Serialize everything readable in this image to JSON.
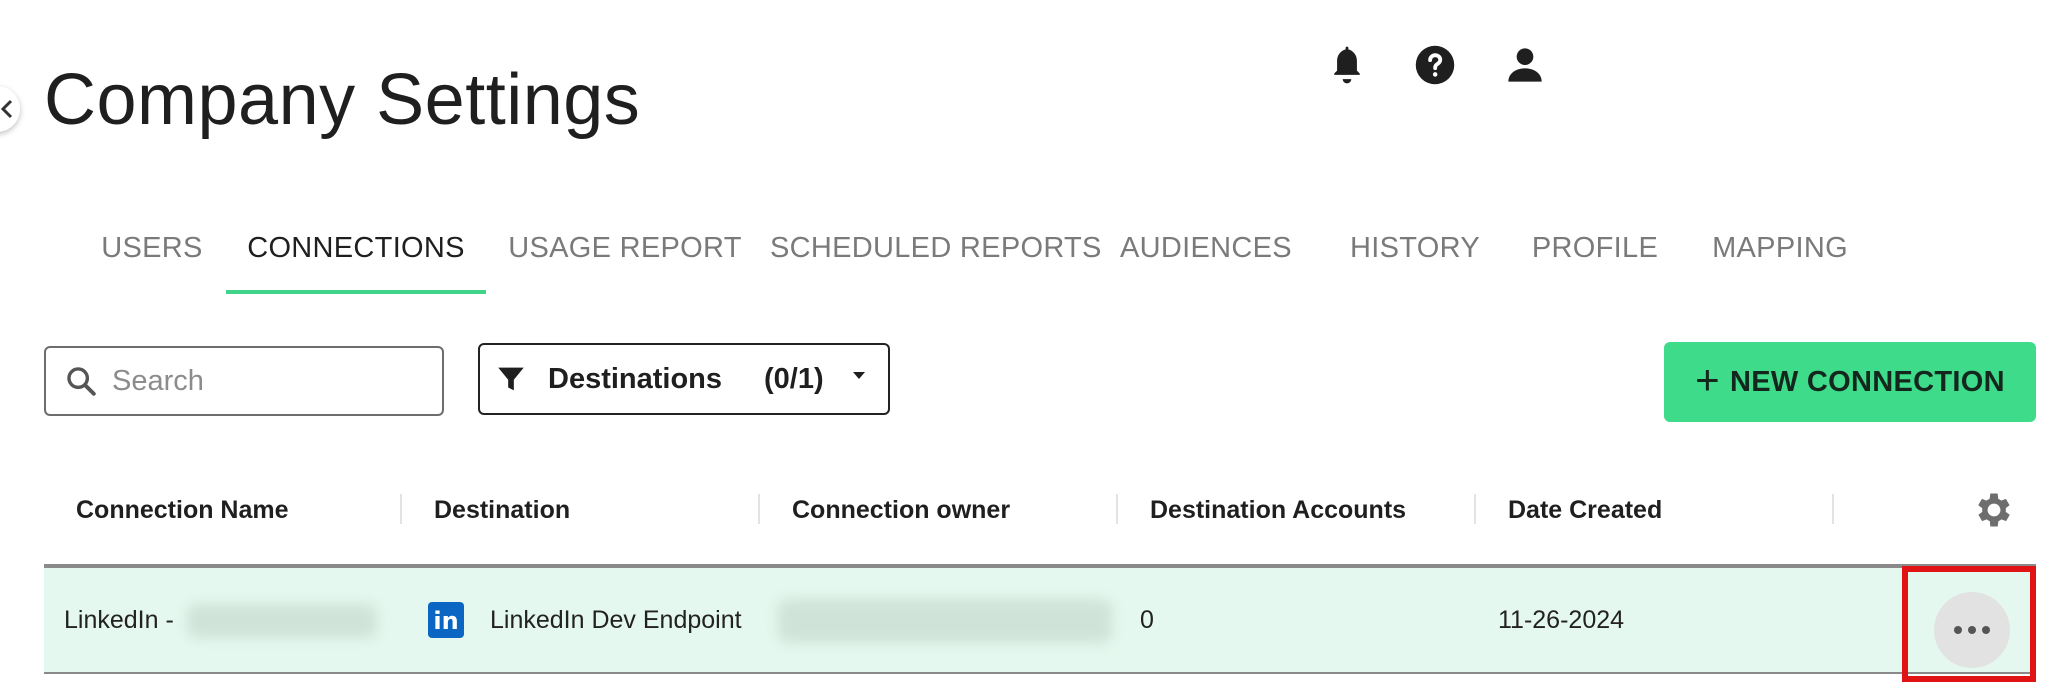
{
  "page": {
    "title": "Company Settings"
  },
  "top_icons": [
    {
      "name": "bell-icon"
    },
    {
      "name": "help-icon"
    },
    {
      "name": "user-icon"
    }
  ],
  "tabs": [
    {
      "label": "USERS",
      "active": false
    },
    {
      "label": "CONNECTIONS",
      "active": true
    },
    {
      "label": "USAGE REPORT",
      "active": false
    },
    {
      "label": "SCHEDULED REPORTS",
      "active": false
    },
    {
      "label": "AUDIENCES",
      "active": false
    },
    {
      "label": "HISTORY",
      "active": false
    },
    {
      "label": "PROFILE",
      "active": false
    },
    {
      "label": "MAPPING",
      "active": false
    }
  ],
  "toolbar": {
    "search_placeholder": "Search",
    "filter_label": "Destinations",
    "filter_count": "(0/1)",
    "new_connection_label": "NEW CONNECTION"
  },
  "table": {
    "columns": [
      "Connection Name",
      "Destination",
      "Connection owner",
      "Destination Accounts",
      "Date Created"
    ],
    "rows": [
      {
        "connection_name": "LinkedIn -",
        "destination": "LinkedIn Dev Endpoint",
        "destination_accounts": "0",
        "date_created": "11-26-2024"
      }
    ]
  },
  "colors": {
    "accent": "#3ddb8a",
    "tab_underline": "#3fd48a",
    "row_highlight": "#e5f8ef",
    "highlight_box": "#e01414",
    "linkedin": "#0a66c2"
  }
}
